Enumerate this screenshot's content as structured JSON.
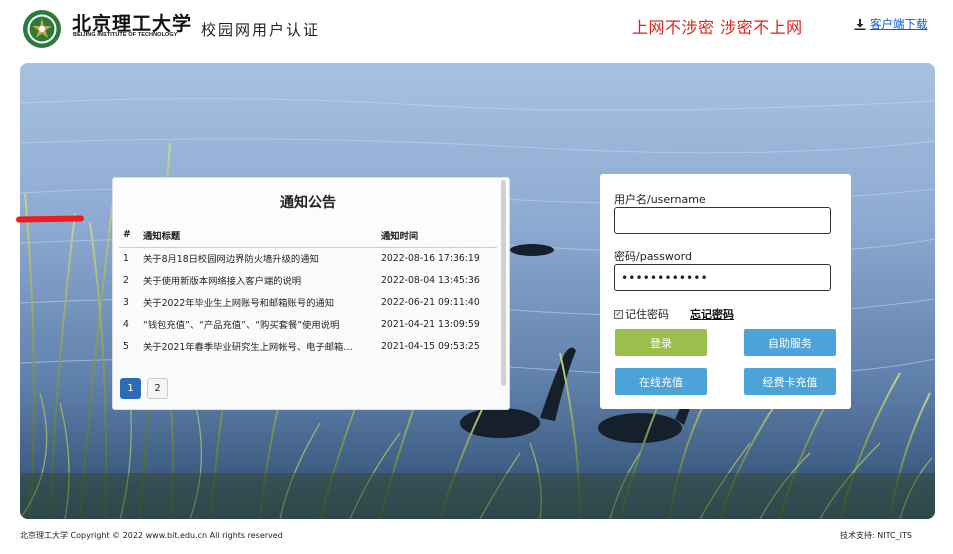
{
  "header": {
    "brand_cn": "北京理工大学",
    "brand_en": "BEIJING INSTITUTE OF TECHNOLOGY",
    "portal_title": "校园网用户认证",
    "slogan": "上网不涉密 涉密不上网",
    "download_label": "客户端下载",
    "download_icon": "download-icon",
    "colors": {
      "slogan": "#d9261c",
      "link": "#0b5bd3"
    }
  },
  "notice": {
    "title": "通知公告",
    "columns": [
      "#",
      "通知标题",
      "通知时间"
    ],
    "rows": [
      {
        "no": "1",
        "title": "关于8月18日校园网边界防火墙升级的通知",
        "time": "2022-08-16 17:36:19"
      },
      {
        "no": "2",
        "title": "关于使用新版本网络接入客户端的说明",
        "time": "2022-08-04 13:45:36"
      },
      {
        "no": "3",
        "title": "关于2022年毕业生上网账号和邮箱账号的通知",
        "time": "2022-06-21 09:11:40"
      },
      {
        "no": "4",
        "title": "“钱包充值”、“产品充值”、“购买套餐”使用说明",
        "time": "2021-04-21 13:09:59"
      },
      {
        "no": "5",
        "title": "关于2021年春季毕业研究生上网帐号、电子邮箱…",
        "time": "2021-04-15 09:53:25"
      }
    ],
    "pages": [
      "1",
      "2"
    ],
    "active_page": "1"
  },
  "login": {
    "username_label": "用户名/username",
    "username_value": "",
    "password_label": "密码/password",
    "password_value": "••••••••••••",
    "remember_label": "记住密码",
    "remember_checked": true,
    "forgot_label": "忘记密码",
    "buttons": {
      "login": "登录",
      "self_service": "自助服务",
      "online_recharge": "在线充值",
      "card_recharge": "经费卡充值"
    },
    "colors": {
      "login": "#9bbf4c",
      "secondary": "#4ba3d7",
      "active_page": "#2d6bb6"
    }
  },
  "footer": {
    "copyright": "北京理工大学 Copyright © 2022 www.bit.edu.cn All rights reserved",
    "support": "技术支持: NITC_ITS"
  }
}
